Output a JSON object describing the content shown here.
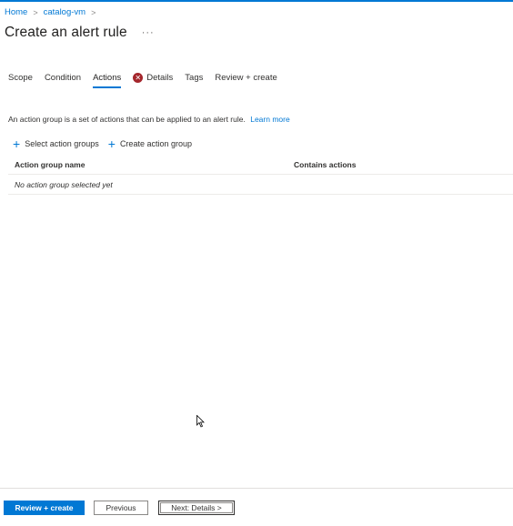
{
  "breadcrumb": {
    "items": [
      "Home",
      "catalog-vm"
    ],
    "separator": ">"
  },
  "header": {
    "title": "Create an alert rule",
    "more": "···"
  },
  "tabs": [
    {
      "label": "Scope",
      "active": false
    },
    {
      "label": "Condition",
      "active": false
    },
    {
      "label": "Actions",
      "active": true
    },
    {
      "label": "Details",
      "active": false,
      "error": true
    },
    {
      "label": "Tags",
      "active": false
    },
    {
      "label": "Review + create",
      "active": false
    }
  ],
  "description": {
    "text": "An action group is a set of actions that can be applied to an alert rule.",
    "link": "Learn more"
  },
  "toolbar": {
    "select_label": "Select action groups",
    "create_label": "Create action group"
  },
  "table": {
    "headers": {
      "name": "Action group name",
      "actions": "Contains actions"
    },
    "empty": "No action group selected yet"
  },
  "footer": {
    "review": "Review + create",
    "previous": "Previous",
    "next": "Next: Details >"
  },
  "colors": {
    "accent": "#0078d4",
    "error": "#a4262c"
  }
}
